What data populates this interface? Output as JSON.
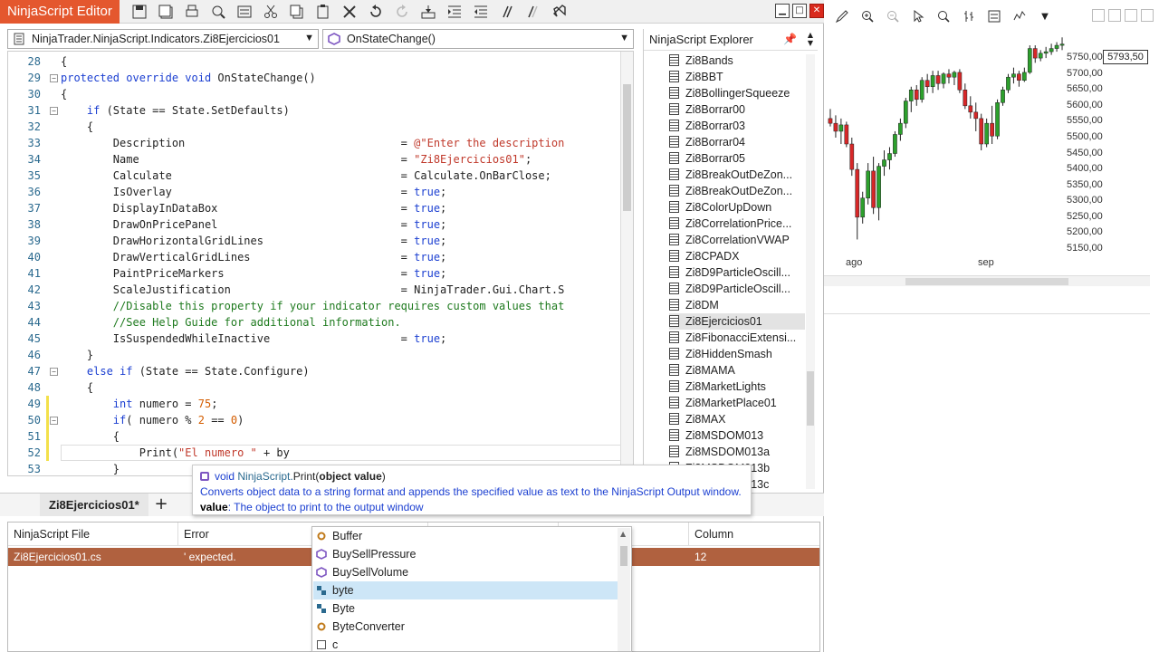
{
  "editor": {
    "title": "NinjaScript Editor",
    "namespace_selector": "NinjaTrader.NinjaScript.Indicators.Zi8Ejercicios01",
    "member_selector": "OnStateChange()",
    "toolbar_icons": [
      "save-icon",
      "save-all-icon",
      "print-icon",
      "find-icon",
      "replace-icon",
      "cut-icon",
      "copy-icon",
      "paste-icon",
      "delete-icon",
      "undo-icon",
      "redo-icon",
      "compile-icon",
      "indent-icon",
      "outdent-icon",
      "comment-icon",
      "uncomment-icon",
      "visual-studio-icon"
    ],
    "window_buttons": [
      "minimize",
      "maximize",
      "close"
    ],
    "close_glyph": "✕",
    "code_lines": [
      {
        "n": "28",
        "indent": 1,
        "fold": "",
        "html": "{"
      },
      {
        "n": "29",
        "indent": 1,
        "fold": "−",
        "html": "<span class='kw'>protected override void</span> OnStateChange()"
      },
      {
        "n": "30",
        "indent": 1,
        "fold": "",
        "html": "{"
      },
      {
        "n": "31",
        "indent": 2,
        "fold": "−",
        "html": "<span class='kw'>if</span> (State == State.SetDefaults)"
      },
      {
        "n": "32",
        "indent": 2,
        "fold": "",
        "html": "{"
      },
      {
        "n": "33",
        "indent": 3,
        "fold": "",
        "html": "Description                                 = <span class='str'>@\"Enter the description</span>"
      },
      {
        "n": "34",
        "indent": 3,
        "fold": "",
        "html": "Name                                        = <span class='str'>\"Zi8Ejercicios01\"</span>;"
      },
      {
        "n": "35",
        "indent": 3,
        "fold": "",
        "html": "Calculate                                   = Calculate.OnBarClose;"
      },
      {
        "n": "36",
        "indent": 3,
        "fold": "",
        "html": "IsOverlay                                   = <span class='kw'>true</span>;"
      },
      {
        "n": "37",
        "indent": 3,
        "fold": "",
        "html": "DisplayInDataBox                            = <span class='kw'>true</span>;"
      },
      {
        "n": "38",
        "indent": 3,
        "fold": "",
        "html": "DrawOnPricePanel                            = <span class='kw'>true</span>;"
      },
      {
        "n": "39",
        "indent": 3,
        "fold": "",
        "html": "DrawHorizontalGridLines                     = <span class='kw'>true</span>;"
      },
      {
        "n": "40",
        "indent": 3,
        "fold": "",
        "html": "DrawVerticalGridLines                       = <span class='kw'>true</span>;"
      },
      {
        "n": "41",
        "indent": 3,
        "fold": "",
        "html": "PaintPriceMarkers                           = <span class='kw'>true</span>;"
      },
      {
        "n": "42",
        "indent": 3,
        "fold": "",
        "html": "ScaleJustification                          = NinjaTrader.Gui.Chart.S"
      },
      {
        "n": "43",
        "indent": 3,
        "fold": "",
        "html": "<span class='cmt'>//Disable this property if your indicator requires custom values that</span>"
      },
      {
        "n": "44",
        "indent": 3,
        "fold": "",
        "html": "<span class='cmt'>//See Help Guide for additional information.</span>"
      },
      {
        "n": "45",
        "indent": 3,
        "fold": "",
        "html": "IsSuspendedWhileInactive                    = <span class='kw'>true</span>;"
      },
      {
        "n": "46",
        "indent": 2,
        "fold": "",
        "html": "}"
      },
      {
        "n": "47",
        "indent": 2,
        "fold": "−",
        "html": "<span class='kw'>else if</span> (State == State.Configure)"
      },
      {
        "n": "48",
        "indent": 2,
        "fold": "",
        "html": "{"
      },
      {
        "n": "49",
        "indent": 3,
        "fold": "",
        "changed": true,
        "html": "<span class='kw'>int</span> numero = <span class='num'>75</span>;"
      },
      {
        "n": "50",
        "indent": 3,
        "fold": "−",
        "changed": true,
        "html": "<span class='kw'>if</span>( numero % <span class='num'>2</span> == <span class='num'>0</span>)"
      },
      {
        "n": "51",
        "indent": 3,
        "fold": "",
        "changed": true,
        "html": "{"
      },
      {
        "n": "52",
        "indent": 4,
        "fold": "",
        "changed": true,
        "current": true,
        "html": "Print(<span class='str'>\"El numero \"</span> + by"
      },
      {
        "n": "53",
        "indent": 3,
        "fold": "",
        "html": "}"
      }
    ],
    "tab_label": "Zi8Ejercicios01*",
    "add_tab": "+"
  },
  "explorer": {
    "title": "NinjaScript Explorer",
    "pin": "📌",
    "items": [
      "Zi8Bands",
      "Zi8BBT",
      "Zi8BollingerSqueeze",
      "Zi8Borrar00",
      "Zi8Borrar03",
      "Zi8Borrar04",
      "Zi8Borrar05",
      "Zi8BreakOutDeZon...",
      "Zi8BreakOutDeZon...",
      "Zi8ColorUpDown",
      "Zi8CorrelationPrice...",
      "Zi8CorrelationVWAP",
      "Zi8CPADX",
      "Zi8D9ParticleOscill...",
      "Zi8D9ParticleOscill...",
      "Zi8DM",
      "Zi8Ejercicios01",
      "Zi8FibonacciExtensi...",
      "Zi8HiddenSmash",
      "Zi8MAMA",
      "Zi8MarketLights",
      "Zi8MarketPlace01",
      "Zi8MAX",
      "Zi8MSDOM013",
      "Zi8MSDOM013a",
      "Zi8MSDOM013b",
      "Zi8MSDOM013c"
    ],
    "selected": "Zi8Ejercicios01"
  },
  "errors": {
    "columns": [
      "NinjaScript File",
      "Error",
      "",
      "",
      "Column"
    ],
    "row": {
      "file": "Zi8Ejercicios01.cs",
      "error": "' expected.",
      "column": "12"
    }
  },
  "tooltip": {
    "kw": "void",
    "ns": "NinjaScript.",
    "method": "Print(",
    "param_sig": "object value",
    "close_paren": ")",
    "description": "Converts object data to a string format and appends the specified value as text to the NinjaScript Output window.",
    "param_name": "value",
    "param_desc": ": The object to print to the output window"
  },
  "completion": {
    "items": [
      {
        "label": "Buffer",
        "icon": "gear"
      },
      {
        "label": "BuySellPressure",
        "icon": "cube"
      },
      {
        "label": "BuySellVolume",
        "icon": "cube"
      },
      {
        "label": "byte",
        "icon": "struct"
      },
      {
        "label": "Byte",
        "icon": "struct"
      },
      {
        "label": "ByteConverter",
        "icon": "gear"
      },
      {
        "label": "c",
        "icon": "doc"
      }
    ],
    "selected_index": 3
  },
  "chart": {
    "price_label": "5793,50",
    "price_ticks": [
      "5750,00",
      "5700,00",
      "5650,00",
      "5600,00",
      "5550,00",
      "5500,00",
      "5450,00",
      "5400,00",
      "5350,00",
      "5300,00",
      "5250,00",
      "5200,00",
      "5150,00"
    ],
    "date_ticks": [
      "ago",
      "sep"
    ],
    "up_color": "#2ca02c",
    "down_color": "#d62728",
    "candles": [
      {
        "o": 5560,
        "h": 5590,
        "l": 5535,
        "c": 5545
      },
      {
        "o": 5545,
        "h": 5570,
        "l": 5500,
        "c": 5520
      },
      {
        "o": 5520,
        "h": 5560,
        "l": 5480,
        "c": 5540
      },
      {
        "o": 5540,
        "h": 5550,
        "l": 5470,
        "c": 5480
      },
      {
        "o": 5480,
        "h": 5500,
        "l": 5380,
        "c": 5400
      },
      {
        "o": 5400,
        "h": 5420,
        "l": 5180,
        "c": 5250
      },
      {
        "o": 5250,
        "h": 5330,
        "l": 5230,
        "c": 5310
      },
      {
        "o": 5310,
        "h": 5420,
        "l": 5290,
        "c": 5395
      },
      {
        "o": 5395,
        "h": 5440,
        "l": 5260,
        "c": 5280
      },
      {
        "o": 5280,
        "h": 5420,
        "l": 5240,
        "c": 5410
      },
      {
        "o": 5410,
        "h": 5460,
        "l": 5380,
        "c": 5430
      },
      {
        "o": 5430,
        "h": 5470,
        "l": 5400,
        "c": 5450
      },
      {
        "o": 5450,
        "h": 5520,
        "l": 5440,
        "c": 5510
      },
      {
        "o": 5510,
        "h": 5560,
        "l": 5490,
        "c": 5545
      },
      {
        "o": 5545,
        "h": 5625,
        "l": 5530,
        "c": 5615
      },
      {
        "o": 5615,
        "h": 5660,
        "l": 5580,
        "c": 5650
      },
      {
        "o": 5650,
        "h": 5665,
        "l": 5600,
        "c": 5620
      },
      {
        "o": 5620,
        "h": 5690,
        "l": 5610,
        "c": 5680
      },
      {
        "o": 5680,
        "h": 5700,
        "l": 5640,
        "c": 5660
      },
      {
        "o": 5660,
        "h": 5710,
        "l": 5640,
        "c": 5695
      },
      {
        "o": 5695,
        "h": 5710,
        "l": 5650,
        "c": 5670
      },
      {
        "o": 5670,
        "h": 5705,
        "l": 5655,
        "c": 5700
      },
      {
        "o": 5700,
        "h": 5715,
        "l": 5670,
        "c": 5690
      },
      {
        "o": 5690,
        "h": 5710,
        "l": 5665,
        "c": 5705
      },
      {
        "o": 5705,
        "h": 5715,
        "l": 5640,
        "c": 5650
      },
      {
        "o": 5650,
        "h": 5670,
        "l": 5590,
        "c": 5600
      },
      {
        "o": 5600,
        "h": 5630,
        "l": 5560,
        "c": 5580
      },
      {
        "o": 5580,
        "h": 5610,
        "l": 5520,
        "c": 5560
      },
      {
        "o": 5560,
        "h": 5575,
        "l": 5460,
        "c": 5480
      },
      {
        "o": 5480,
        "h": 5560,
        "l": 5470,
        "c": 5545
      },
      {
        "o": 5545,
        "h": 5600,
        "l": 5480,
        "c": 5505
      },
      {
        "o": 5505,
        "h": 5620,
        "l": 5495,
        "c": 5610
      },
      {
        "o": 5610,
        "h": 5660,
        "l": 5600,
        "c": 5650
      },
      {
        "o": 5650,
        "h": 5700,
        "l": 5640,
        "c": 5690
      },
      {
        "o": 5690,
        "h": 5720,
        "l": 5670,
        "c": 5700
      },
      {
        "o": 5700,
        "h": 5710,
        "l": 5660,
        "c": 5680
      },
      {
        "o": 5680,
        "h": 5720,
        "l": 5675,
        "c": 5705
      },
      {
        "o": 5705,
        "h": 5790,
        "l": 5700,
        "c": 5780
      },
      {
        "o": 5780,
        "h": 5790,
        "l": 5735,
        "c": 5750
      },
      {
        "o": 5750,
        "h": 5775,
        "l": 5740,
        "c": 5765
      },
      {
        "o": 5765,
        "h": 5785,
        "l": 5750,
        "c": 5770
      },
      {
        "o": 5770,
        "h": 5795,
        "l": 5760,
        "c": 5780
      },
      {
        "o": 5780,
        "h": 5800,
        "l": 5770,
        "c": 5790
      },
      {
        "o": 5790,
        "h": 5815,
        "l": 5775,
        "c": 5794
      }
    ],
    "y_min": 5130,
    "y_max": 5830
  }
}
